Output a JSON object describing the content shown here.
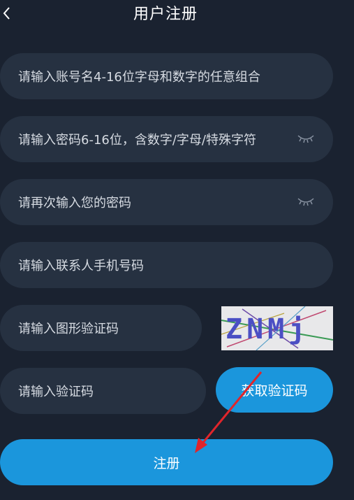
{
  "header": {
    "title": "用户注册",
    "back_icon": "chevron-left-icon"
  },
  "form": {
    "account": {
      "placeholder": "请输入账号名4-16位字母和数字的任意组合"
    },
    "password": {
      "placeholder": "请输入密码6-16位，含数字/字母/特殊字符",
      "toggle_icon": "eye-closed-icon"
    },
    "confirm_password": {
      "placeholder": "请再次输入您的密码",
      "toggle_icon": "eye-closed-icon"
    },
    "phone": {
      "placeholder": "请输入联系人手机号码"
    },
    "captcha": {
      "placeholder": "请输入图形验证码",
      "image_text": "ZNMj"
    },
    "sms_code": {
      "placeholder": "请输入验证码",
      "button_label": "获取验证码"
    },
    "submit_label": "注册"
  },
  "colors": {
    "background": "#1a2230",
    "field": "#263141",
    "accent": "#1b96dc",
    "annotation_arrow": "#e0252b"
  }
}
